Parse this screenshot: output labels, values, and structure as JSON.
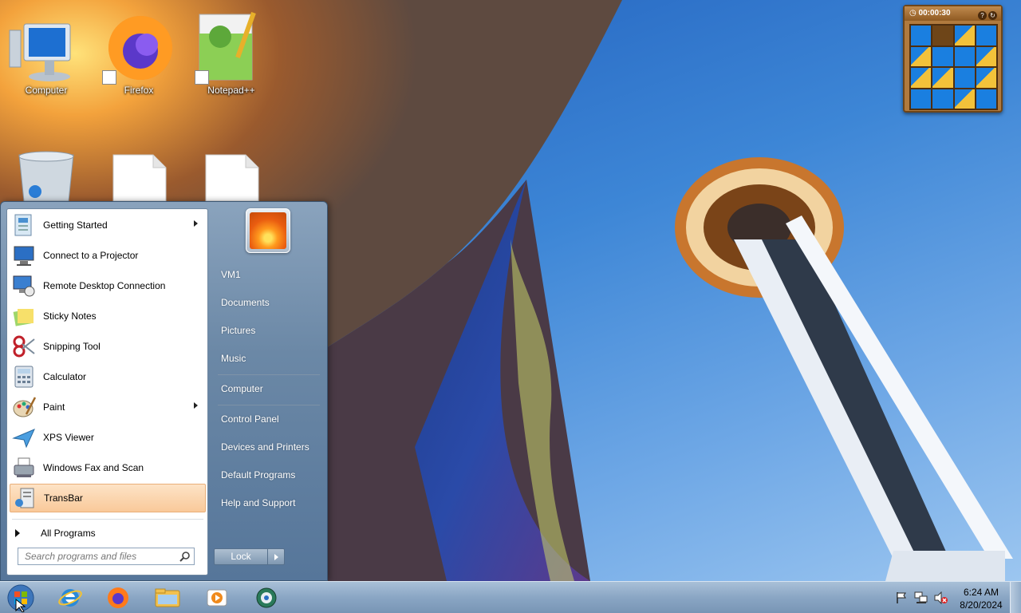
{
  "desktop": {
    "icons": [
      {
        "label": "Computer",
        "icon": "computer-icon"
      },
      {
        "label": "Firefox",
        "icon": "firefox-icon"
      },
      {
        "label": "Notepad++",
        "icon": "notepad-plus-plus-icon"
      },
      {
        "label": "",
        "icon": "recycle-bin-icon"
      },
      {
        "label": "",
        "icon": "file-icon"
      },
      {
        "label": "",
        "icon": "file-icon"
      }
    ]
  },
  "gadget": {
    "timer": "00:00:30",
    "help_icon": "help-icon",
    "refresh_icon": "refresh-icon"
  },
  "start_menu": {
    "programs": [
      {
        "label": "Getting Started",
        "has_submenu": true,
        "icon": "getting-started-icon"
      },
      {
        "label": "Connect to a Projector",
        "has_submenu": false,
        "icon": "projector-icon"
      },
      {
        "label": "Remote Desktop Connection",
        "has_submenu": false,
        "icon": "remote-desktop-icon"
      },
      {
        "label": "Sticky Notes",
        "has_submenu": false,
        "icon": "sticky-notes-icon"
      },
      {
        "label": "Snipping Tool",
        "has_submenu": false,
        "icon": "scissors-icon"
      },
      {
        "label": "Calculator",
        "has_submenu": false,
        "icon": "calculator-icon"
      },
      {
        "label": "Paint",
        "has_submenu": true,
        "icon": "paint-palette-icon"
      },
      {
        "label": "XPS Viewer",
        "has_submenu": false,
        "icon": "xps-viewer-icon"
      },
      {
        "label": "Windows Fax and Scan",
        "has_submenu": false,
        "icon": "fax-icon"
      },
      {
        "label": "TransBar",
        "has_submenu": false,
        "icon": "transbar-icon",
        "highlighted": true
      }
    ],
    "all_programs": "All Programs",
    "search_placeholder": "Search programs and files",
    "right_links": [
      "VM1",
      "Documents",
      "Pictures",
      "Music",
      "Computer",
      "Control Panel",
      "Devices and Printers",
      "Default Programs",
      "Help and Support"
    ],
    "lock_button": "Lock"
  },
  "taskbar": {
    "pinned": [
      "internet-explorer-icon",
      "firefox-icon",
      "file-explorer-icon",
      "media-player-icon",
      "app-globe-icon"
    ],
    "tray_icons": [
      "action-center-flag-icon",
      "network-icon",
      "volume-muted-icon"
    ],
    "time": "6:24 AM",
    "date": "8/20/2024"
  },
  "colors": {
    "sky": "#2a6fc4",
    "taskbar": "#8aa6c4",
    "highlight": "#f9c99a"
  }
}
